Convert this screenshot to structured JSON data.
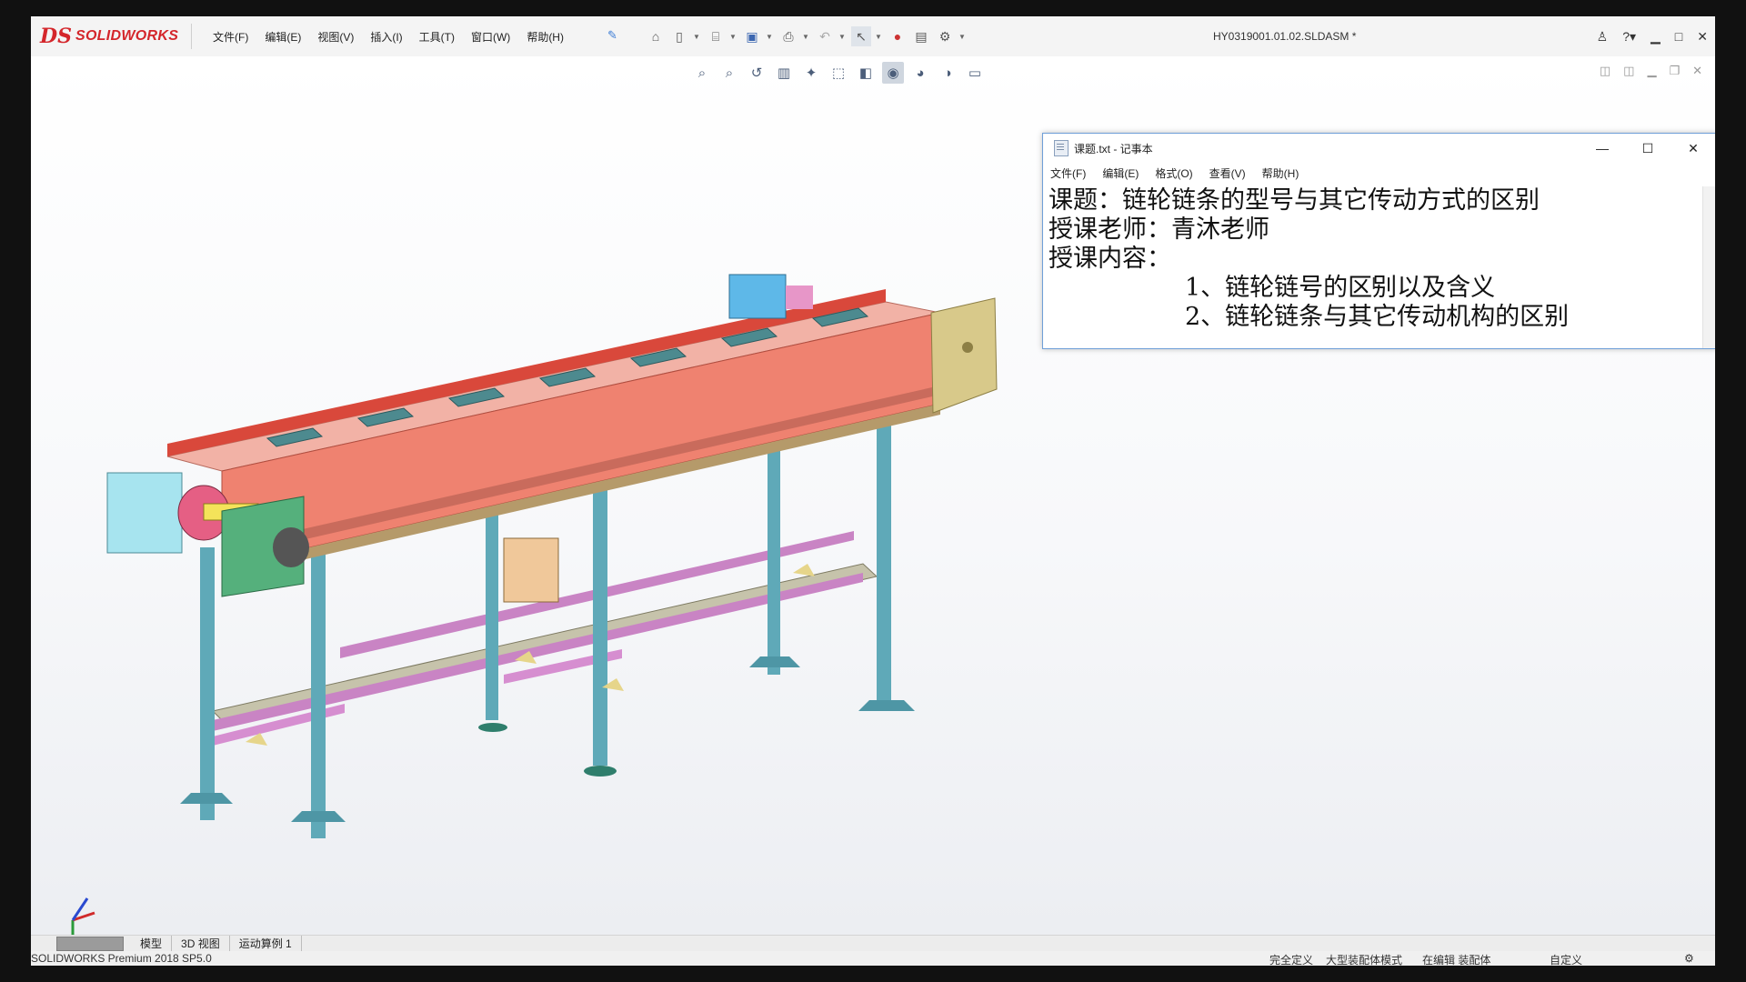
{
  "app": {
    "brand_mark": "DS",
    "brand_name": "SOLIDWORKS",
    "document_title": "HY0319001.01.02.SLDASM *"
  },
  "menubar": {
    "items": [
      "文件(F)",
      "编辑(E)",
      "视图(V)",
      "插入(I)",
      "工具(T)",
      "窗口(W)",
      "帮助(H)"
    ]
  },
  "notepad": {
    "title": "课题.txt - 记事本",
    "menu": [
      "文件(F)",
      "编辑(E)",
      "格式(O)",
      "查看(V)",
      "帮助(H)"
    ],
    "lines": [
      "课题：链轮链条的型号与其它传动方式的区别",
      "授课老师：青沐老师",
      "授课内容：",
      "1、链轮链号的区别以及含义",
      "2、链轮链条与其它传动机构的区别"
    ]
  },
  "bottom_tabs": [
    "模型",
    "3D 视图",
    "运动算例 1"
  ],
  "status": {
    "product": "SOLIDWORKS Premium 2018 SP5.0",
    "fully_defined": "完全定义",
    "large_assembly": "大型装配体模式",
    "editing": "在编辑 装配体",
    "custom": "自定义"
  },
  "colors": {
    "brand_red": "#d4262b",
    "top_frame": "#d9483b",
    "side_panel": "#ef8270",
    "legs": "#5fa9b8",
    "base_rails": "#c984c4",
    "motor": "#5eb8e8",
    "end_plate": "#d8c98a",
    "notepad_border": "#6f9fd8"
  }
}
